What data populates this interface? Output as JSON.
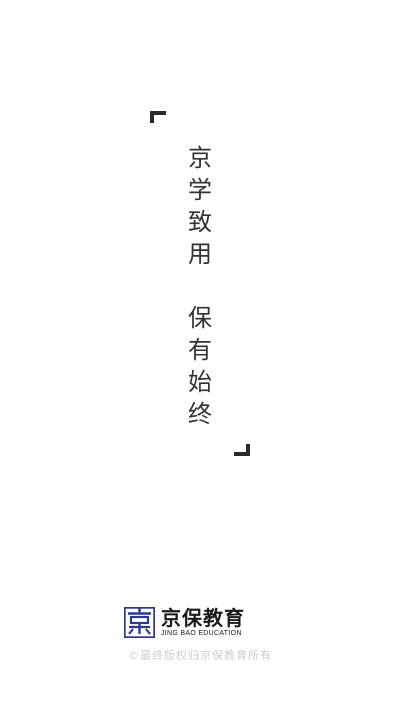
{
  "slogan": {
    "line1": [
      "京",
      "学",
      "致",
      "用"
    ],
    "line2": [
      "保",
      "有",
      "始",
      "终"
    ]
  },
  "brand": {
    "name": "京保教育",
    "english": "JING BAO EDUCATION",
    "logo_icon": "jingbao-logo-icon",
    "logo_color": "#2b3a8f"
  },
  "footer": {
    "copyright": "©最终版权归京保教育所有"
  },
  "colors": {
    "background": "#ffffff",
    "slogan_text": "#333333",
    "corner_marks": "#2a2a2a",
    "copyright_text": "#cfcfcf"
  }
}
